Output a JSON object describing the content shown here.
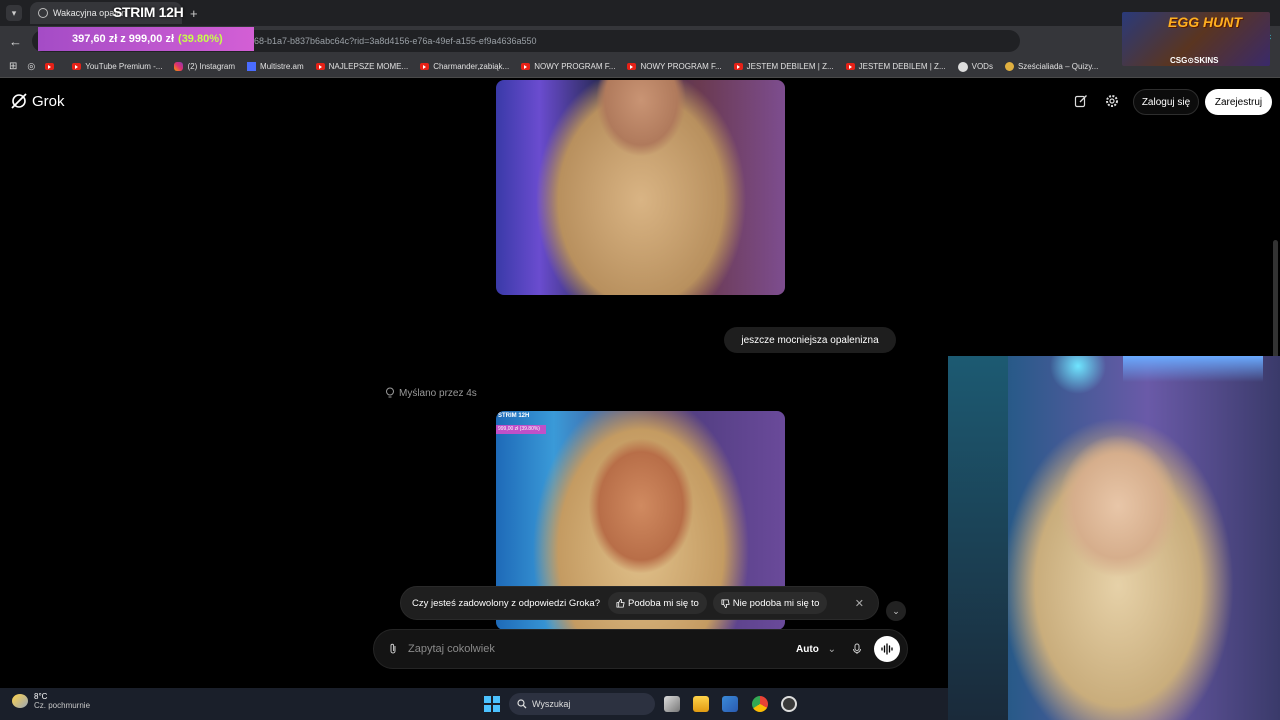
{
  "browser": {
    "tab_title": "Wakacyjna opalen",
    "url_fragment": "68-b1a7-b837b6abc64c?rid=3a8d4156-e76a-49ef-a155-ef9a4636a550",
    "bookmarks": [
      {
        "icon": "youtube-icon",
        "label": "YouTube Premium -..."
      },
      {
        "icon": "instagram-icon",
        "label": "(2) Instagram"
      },
      {
        "icon": "multistream-icon",
        "label": "Multistre.am"
      },
      {
        "icon": "youtube-icon",
        "label": "NAJLEPSZE MOME..."
      },
      {
        "icon": "youtube-icon",
        "label": "Charmander,zabiąk..."
      },
      {
        "icon": "youtube-icon",
        "label": "NOWY PROGRAM F..."
      },
      {
        "icon": "youtube-icon",
        "label": "NOWY PROGRAM F..."
      },
      {
        "icon": "youtube-icon",
        "label": "JESTEM DEBILEM | Z..."
      },
      {
        "icon": "youtube-icon",
        "label": "JESTEM DEBILEM | Z..."
      },
      {
        "icon": "globe-icon",
        "label": "VODs"
      },
      {
        "icon": "quiz-icon",
        "label": "Sześcialiada – Quizy..."
      }
    ]
  },
  "stream_overlay": {
    "title": "STRIM 12H",
    "goal_current": "397,60 zł",
    "goal_sep": "z",
    "goal_target": "999,00 zł",
    "goal_percent": "(39.80%)",
    "goal_fraction": 0.398,
    "promo_title": "EGG HUNT",
    "promo_sponsor": "CSG⊙SKINS"
  },
  "grok": {
    "logo": "Grok",
    "login_label": "Zaloguj się",
    "register_label": "Zarejestruj",
    "user_message": "jeszcze mocniejsza opalenizna",
    "thought_label": "Myślano przez 4s",
    "image_overlay_title": "STRIM 12H",
    "image_overlay_goal": "999,00 zł (39.80%)",
    "feedback": {
      "question": "Czy jesteś zadowolony z odpowiedzi Groka?",
      "like_label": "Podoba mi się to",
      "dislike_label": "Nie podoba mi się to"
    },
    "composer": {
      "placeholder": "Zapytaj cokolwiek",
      "mode_label": "Auto"
    }
  },
  "taskbar": {
    "temperature": "8°C",
    "weather_desc": "Cz. pochmurnie",
    "search_label": "Wyszukaj"
  },
  "colors": {
    "background": "#000000",
    "goal_bar": "#c055cf",
    "goal_percent": "#c6ff4a",
    "windows_accent": "#4cc2ff"
  }
}
